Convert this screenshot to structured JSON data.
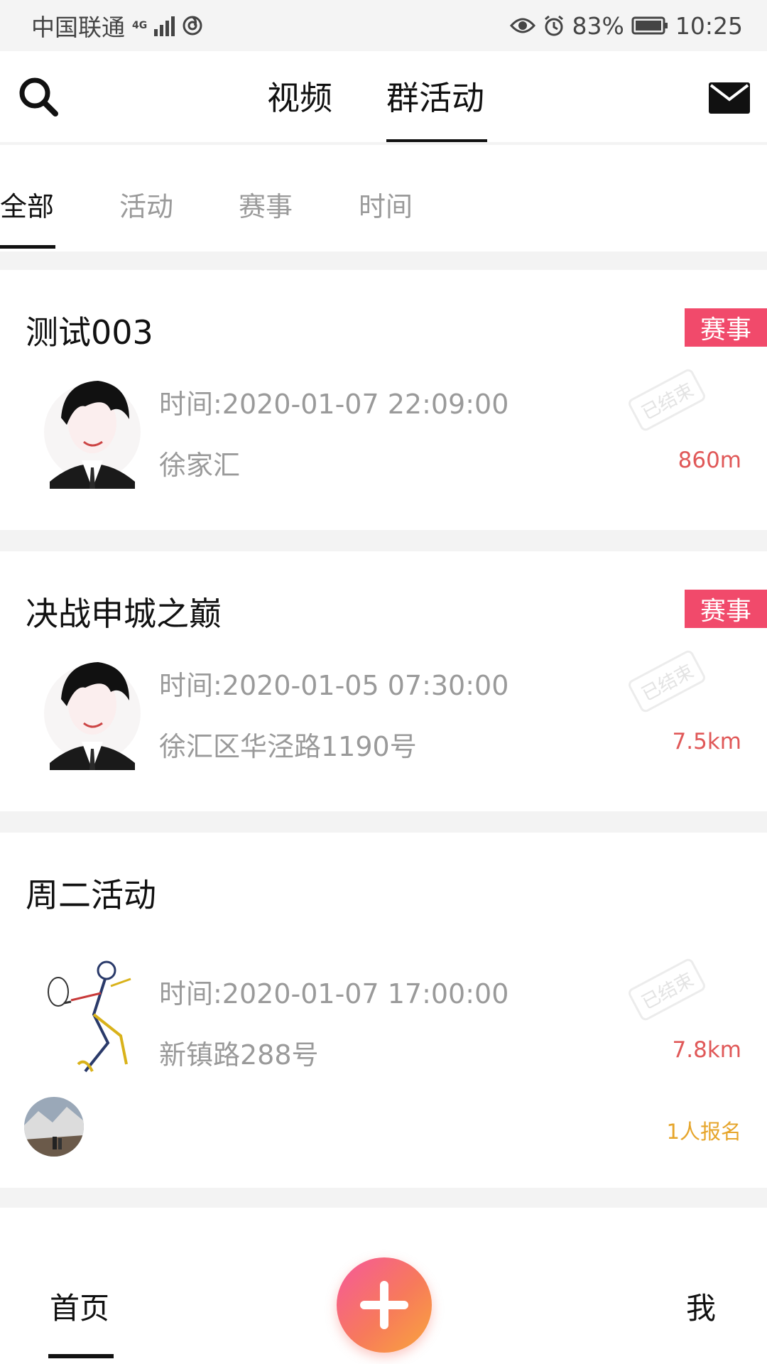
{
  "status_bar": {
    "carrier": "中国联通",
    "network": "4G",
    "battery_percent": "83%",
    "time": "10:25",
    "icons": [
      "signal-icon",
      "hotspot-icon",
      "eye-icon",
      "alarm-icon",
      "battery-icon"
    ]
  },
  "top_nav": {
    "search_icon": "search-icon",
    "tabs": [
      "视频",
      "群活动"
    ],
    "active_tab": "群活动",
    "mail_icon": "mail-icon"
  },
  "filter_tabs": {
    "items": [
      "全部",
      "活动",
      "赛事",
      "时间"
    ],
    "active": "全部"
  },
  "events": [
    {
      "title": "测试003",
      "badge": "赛事",
      "time": "时间:2020-01-07 22:09:00",
      "address": "徐家汇",
      "distance": "860m",
      "stamp": "已结束",
      "thumb": "anime-boy-avatar"
    },
    {
      "title": "决战申城之巅",
      "badge": "赛事",
      "time": "时间:2020-01-05 07:30:00",
      "address": "徐汇区华泾路1190号",
      "distance": "7.5km",
      "stamp": "已结束",
      "thumb": "anime-boy-avatar"
    },
    {
      "title": "周二活动",
      "time": "时间:2020-01-07 17:00:00",
      "address": "新镇路288号",
      "distance": "7.8km",
      "stamp": "已结束",
      "thumb": "tennis-player-sketch",
      "signup": "1人报名",
      "participant_avatar": "landscape-avatar"
    }
  ],
  "bottom_nav": {
    "home": "首页",
    "add_icon": "plus-icon",
    "me": "我"
  },
  "colors": {
    "badge": "#f14a6b",
    "distance": "#e05858",
    "signup": "#e6a52b",
    "fab_start": "#f6589b",
    "fab_end": "#f9a63c"
  }
}
